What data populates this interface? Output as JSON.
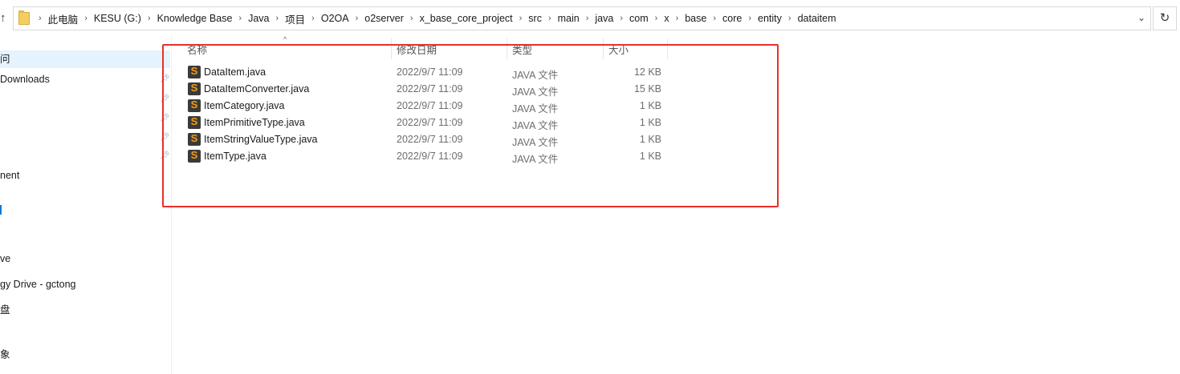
{
  "address": {
    "crumbs": [
      "此电脑",
      "KESU (G:)",
      "Knowledge Base",
      "Java",
      "项目",
      "O2OA",
      "o2server",
      "x_base_core_project",
      "src",
      "main",
      "java",
      "com",
      "x",
      "base",
      "core",
      "entity",
      "dataitem"
    ]
  },
  "nav": {
    "items": [
      {
        "label": "问",
        "selected": true
      },
      {
        "label": "Downloads"
      },
      {
        "label": "nent"
      },
      {
        "label": ""
      },
      {
        "label": "ve"
      },
      {
        "label": "gy Drive - gctong"
      },
      {
        "label": "盘"
      },
      {
        "label": "象"
      }
    ]
  },
  "columns": {
    "name": "名称",
    "date": "修改日期",
    "type": "类型",
    "size": "大小"
  },
  "files": [
    {
      "name": "DataItem.java",
      "date": "2022/9/7 11:09",
      "type": "JAVA 文件",
      "size": "12 KB"
    },
    {
      "name": "DataItemConverter.java",
      "date": "2022/9/7 11:09",
      "type": "JAVA 文件",
      "size": "15 KB"
    },
    {
      "name": "ItemCategory.java",
      "date": "2022/9/7 11:09",
      "type": "JAVA 文件",
      "size": "1 KB"
    },
    {
      "name": "ItemPrimitiveType.java",
      "date": "2022/9/7 11:09",
      "type": "JAVA 文件",
      "size": "1 KB"
    },
    {
      "name": "ItemStringValueType.java",
      "date": "2022/9/7 11:09",
      "type": "JAVA 文件",
      "size": "1 KB"
    },
    {
      "name": "ItemType.java",
      "date": "2022/9/7 11:09",
      "type": "JAVA 文件",
      "size": "1 KB"
    }
  ],
  "icons": {
    "up": "arrow-up-icon",
    "chevron": "chevron-down-icon",
    "refresh": "refresh-icon",
    "file": "sublime-text-file-icon",
    "folder": "folder-icon",
    "pin": "pin-icon"
  },
  "colors": {
    "highlight": "#e8302a",
    "selection": "#e5f3ff"
  }
}
